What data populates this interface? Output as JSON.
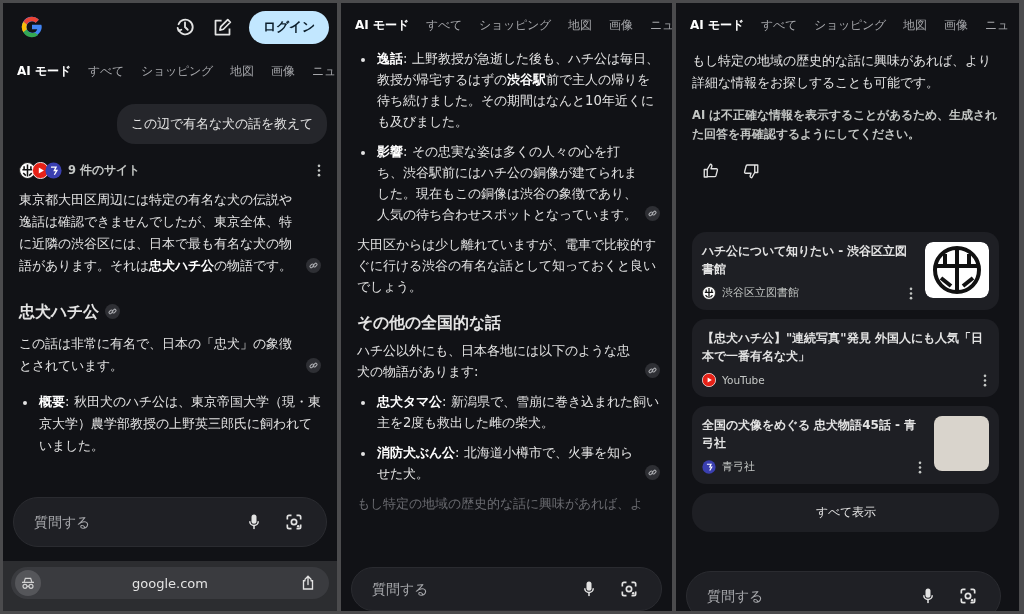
{
  "screens": [
    {
      "header": {
        "login": "ログイン"
      },
      "tabs": [
        {
          "label": "AI モード",
          "selected": true
        },
        {
          "label": "すべて",
          "selected": false
        },
        {
          "label": "ショッピング",
          "selected": false
        },
        {
          "label": "地図",
          "selected": false
        },
        {
          "label": "画像",
          "selected": false
        },
        {
          "label": "ニュ",
          "selected": false
        }
      ],
      "blocks": [
        {
          "kind": "query",
          "text": "この辺で有名な犬の話を教えて"
        },
        {
          "kind": "sources",
          "text": "9 件のサイト",
          "favicons": [
            {
              "kind": "emblem"
            },
            {
              "kind": "play"
            },
            {
              "kind": "seal"
            }
          ]
        },
        {
          "kind": "paragraph",
          "text": "東京都大田区周辺には特定の有名な犬の伝説や逸話は確認できませんでしたが、東京全体、特に近隣の渋谷区には、日本で最も有名な犬の物語があります。それは**忠犬ハチ公**の物語です。",
          "link": true,
          "faded": false
        },
        {
          "kind": "heading",
          "text": "忠犬ハチ公",
          "link": true
        },
        {
          "kind": "paragraph",
          "text": "この話は非常に有名で、日本の「忠犬」の象徴とされています。",
          "link": true,
          "faded": false
        },
        {
          "kind": "bullet",
          "text": "**概要**: 秋田犬のハチ公は、東京帝国大学（現・東京大学）農学部教授の上野英三郎氏に飼われていました。",
          "link": false
        }
      ],
      "ask": {
        "placeholder": "質問する"
      },
      "url_bar": {
        "url": "google.com"
      }
    },
    {
      "tabs": [
        {
          "label": "AI モード",
          "selected": true
        },
        {
          "label": "すべて",
          "selected": false
        },
        {
          "label": "ショッピング",
          "selected": false
        },
        {
          "label": "地図",
          "selected": false
        },
        {
          "label": "画像",
          "selected": false
        },
        {
          "label": "ニュ",
          "selected": false
        }
      ],
      "blocks": [
        {
          "kind": "bullet",
          "text": "**逸話**: 上野教授が急逝した後も、ハチ公は毎日、教授が帰宅するはずの**渋谷駅**前で主人の帰りを待ち続けました。その期間はなんと10年近くにも及びました。",
          "link": false
        },
        {
          "kind": "bullet",
          "text": "**影響**: その忠実な姿は多くの人々の心を打ち、渋谷駅前にはハチ公の銅像が建てられました。現在もこの銅像は渋谷の象徴であり、人気の待ち合わせスポットとなっています。",
          "link": true
        },
        {
          "kind": "paragraph",
          "text": "大田区からは少し離れていますが、電車で比較的すぐに行ける渋谷の有名な話として知っておくと良いでしょう。",
          "link": false,
          "faded": false
        },
        {
          "kind": "heading",
          "text": "その他の全国的な話",
          "link": false
        },
        {
          "kind": "paragraph",
          "text": "ハチ公以外にも、日本各地には以下のような忠犬の物語があります:",
          "link": true,
          "faded": false
        },
        {
          "kind": "bullet",
          "text": "**忠犬タマ公**: 新潟県で、雪崩に巻き込まれた飼い主を2度も救出した雌の柴犬。",
          "link": false
        },
        {
          "kind": "bullet",
          "text": "**消防犬ぶん公**: 北海道小樽市で、火事を知らせた犬。",
          "link": true
        },
        {
          "kind": "paragraph",
          "text": "もし特定の地域の歴史的な話に興味があれば、よ",
          "link": false,
          "faded": true
        }
      ],
      "ask": {
        "placeholder": "質問する"
      }
    },
    {
      "tabs": [
        {
          "label": "AI モード",
          "selected": true
        },
        {
          "label": "すべて",
          "selected": false
        },
        {
          "label": "ショッピング",
          "selected": false
        },
        {
          "label": "地図",
          "selected": false
        },
        {
          "label": "画像",
          "selected": false
        },
        {
          "label": "ニュ",
          "selected": false
        }
      ],
      "blocks": [
        {
          "kind": "paragraph",
          "text": "もし特定の地域の歴史的な話に興味があれば、より詳細な情報をお探しすることも可能です。",
          "link": false,
          "faded": false
        },
        {
          "kind": "disclaimer",
          "text": "AI は不正確な情報を表示することがあるため、生成された回答を再確認するようにしてください。"
        },
        {
          "kind": "feedback"
        },
        {
          "kind": "source_card",
          "title": "ハチ公について知りたい - 渋谷区立図書館",
          "site": "渋谷区立図書館",
          "favicon": {
            "kind": "emblem"
          },
          "thumbnail": {
            "kind": "emblem"
          }
        },
        {
          "kind": "source_card",
          "title": "【忠犬ハチ公】\"連続写真\"発見 外国人にも人気「日本で一番有名な犬」",
          "site": "YouTube",
          "favicon": {
            "kind": "play"
          }
        },
        {
          "kind": "source_card",
          "title": "全国の犬像をめぐる 忠犬物語45話 - 青弓社",
          "site": "青弓社",
          "favicon": {
            "kind": "seal"
          },
          "thumbnail": {
            "kind": "photo"
          }
        },
        {
          "kind": "show_all",
          "text": "すべて表示"
        }
      ],
      "ask": {
        "placeholder": "質問する"
      }
    }
  ]
}
